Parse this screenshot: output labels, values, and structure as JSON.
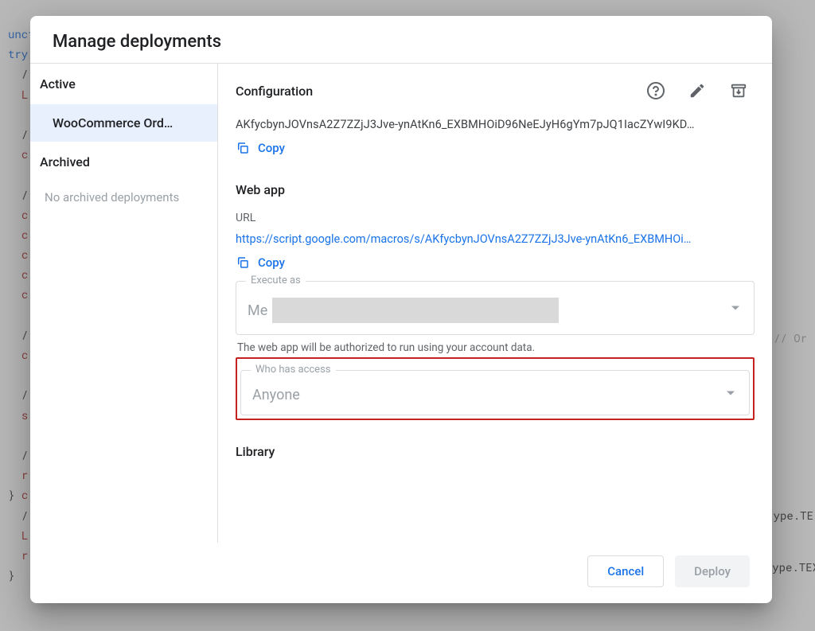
{
  "dialog": {
    "title": "Manage deployments",
    "sidebar": {
      "active_header": "Active",
      "items": [
        {
          "label": "WooCommerce Ord…",
          "selected": true
        }
      ],
      "archived_header": "Archived",
      "archived_empty": "No archived deployments"
    },
    "main": {
      "config_header": "Configuration",
      "deployment_id": "AKfycbynJOVnsA2Z7ZZjJ3Jve-ynAtKn6_EXBMHOiD96NeEJyH6gYm7pJQ1IacZYwI9KD…",
      "copy_label": "Copy",
      "webapp_title": "Web app",
      "url_label": "URL",
      "url_value": "https://script.google.com/macros/s/AKfycbynJOVnsA2Z7ZZjJ3Jve-ynAtKn6_EXBMHOi…",
      "execute_as_label": "Execute as",
      "execute_as_value": "Me",
      "execute_as_helper": "The web app will be authorized to run using your account data.",
      "access_label": "Who has access",
      "access_value": "Anyone",
      "library_title": "Library"
    },
    "footer": {
      "cancel": "Cancel",
      "deploy": "Deploy"
    }
  },
  "bg": {
    "snippets": [
      "unct",
      "try",
      "  /",
      "  L",
      "",
      "  /",
      "  c",
      "",
      "  /",
      "  c",
      "  c",
      "  c",
      "  c",
      "  c",
      "",
      "  /",
      "  c",
      "",
      "  /",
      "  s",
      "",
      "  /",
      "  r",
      "} c",
      "  /",
      "  L",
      "  r",
      "}"
    ],
    "right1": "// Or",
    "right2": "ype.TE",
    "right3": "ype.TEX"
  }
}
